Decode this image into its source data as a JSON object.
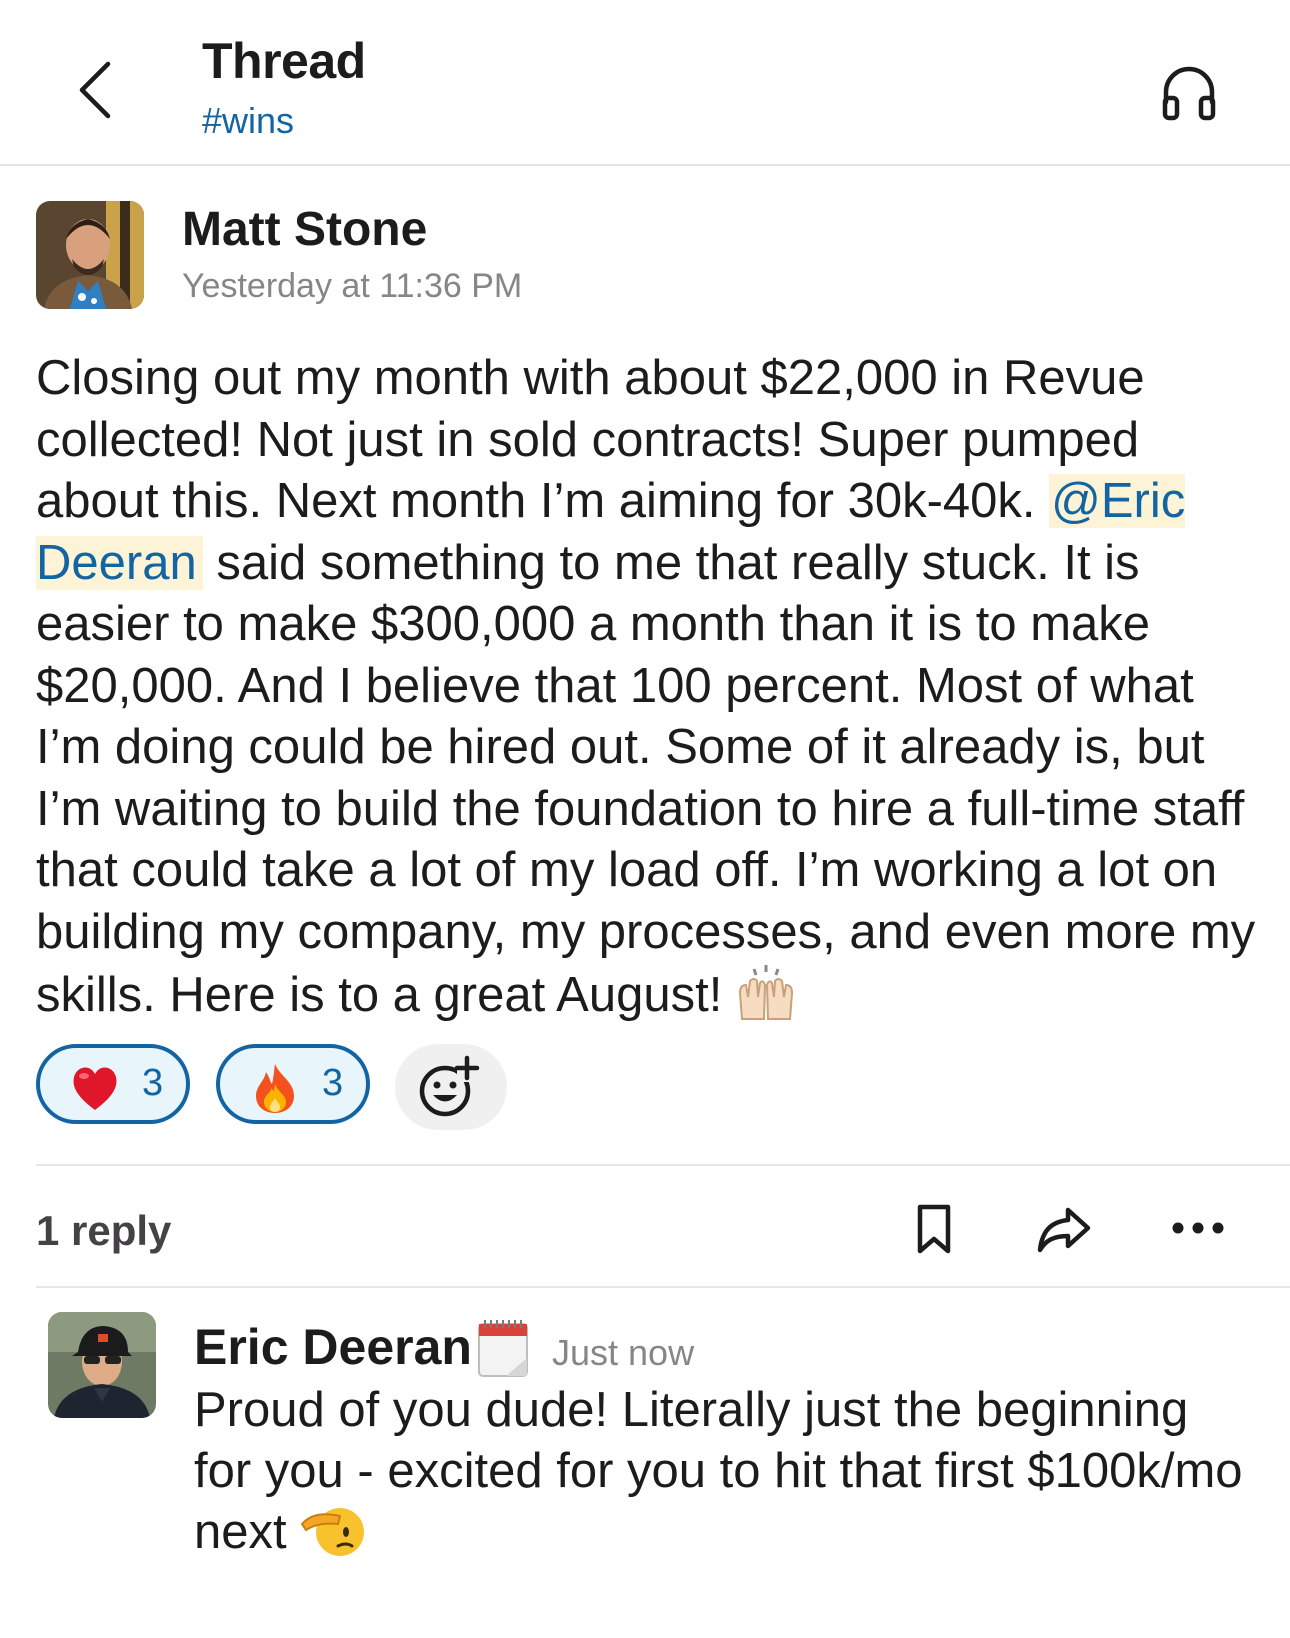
{
  "header": {
    "title": "Thread",
    "channel": "#wins"
  },
  "post": {
    "author": "Matt Stone",
    "timestamp": "Yesterday at 11:36 PM",
    "text_before_mention": "Closing out my month with about $22,000 in Revue collected! Not just in sold contracts! Super pumped about this. Next month I’m aiming for 30k-40k. ",
    "mention": "@Eric Deeran",
    "text_after_mention": " said something to me that really stuck. It is easier to make $300,000 a month than it is to make $20,000. And I believe that 100 percent. Most of what I’m doing could be hired out. Some of it already is, but I’m waiting to build the foundation to hire a full-time staff that could take a lot of my load off. I’m working a lot on building my company, my processes, and even more my skills. Here is to a great August! ",
    "trailing_emoji": "raising-hands-emoji",
    "reactions": [
      {
        "emoji": "red-heart-emoji",
        "count": "3"
      },
      {
        "emoji": "fire-emoji",
        "count": "3"
      }
    ]
  },
  "thread": {
    "reply_count": "1 reply"
  },
  "reply": {
    "author": "Eric Deeran",
    "status_emoji": "calendar-emoji",
    "timestamp": "Just now",
    "text": "Proud of you dude! Literally just the beginning for you - excited for you to hit that first $100k/mo next ",
    "trailing_emoji": "saluting-face-emoji"
  },
  "colors": {
    "link": "#1264a3",
    "mention_bg": "#fdf3d6",
    "reaction_border": "#1264a3",
    "reaction_bg": "#e8f5fa"
  }
}
